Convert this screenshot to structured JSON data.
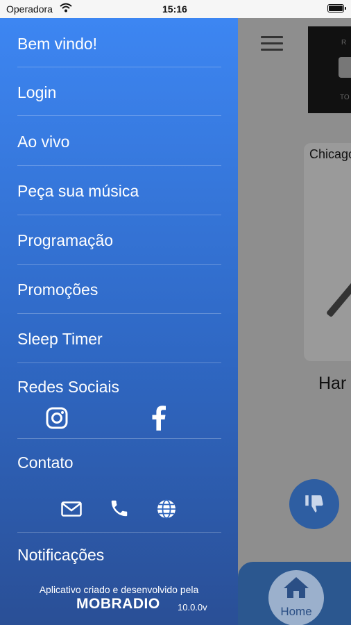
{
  "status_bar": {
    "carrier": "Operadora",
    "time": "15:16"
  },
  "drawer": {
    "menu": [
      {
        "label": "Bem vindo!"
      },
      {
        "label": "Login"
      },
      {
        "label": "Ao vivo"
      },
      {
        "label": "Peça sua música"
      },
      {
        "label": "Programação"
      },
      {
        "label": "Promoções"
      },
      {
        "label": "Sleep Timer"
      },
      {
        "label": "Redes Sociais"
      },
      {
        "label": "Contato"
      },
      {
        "label": "Notificações"
      }
    ],
    "social_icons": [
      "instagram-icon",
      "facebook-icon"
    ],
    "contact_icons": [
      "mail-icon",
      "phone-icon",
      "globe-icon"
    ],
    "footer": {
      "credit": "Aplicativo criado e desenvolvido pela",
      "brand": "MOBRADIO",
      "version": "10.0.0v"
    },
    "colors": {
      "gradient_top": "#3d86f2",
      "gradient_bottom": "#2a4f96"
    }
  },
  "background_app": {
    "card_title": "Chicago",
    "song_title": "Har",
    "logo_letters": {
      "top": "R",
      "bottom": "TO"
    },
    "bottom_nav": {
      "home_label": "Home"
    }
  }
}
